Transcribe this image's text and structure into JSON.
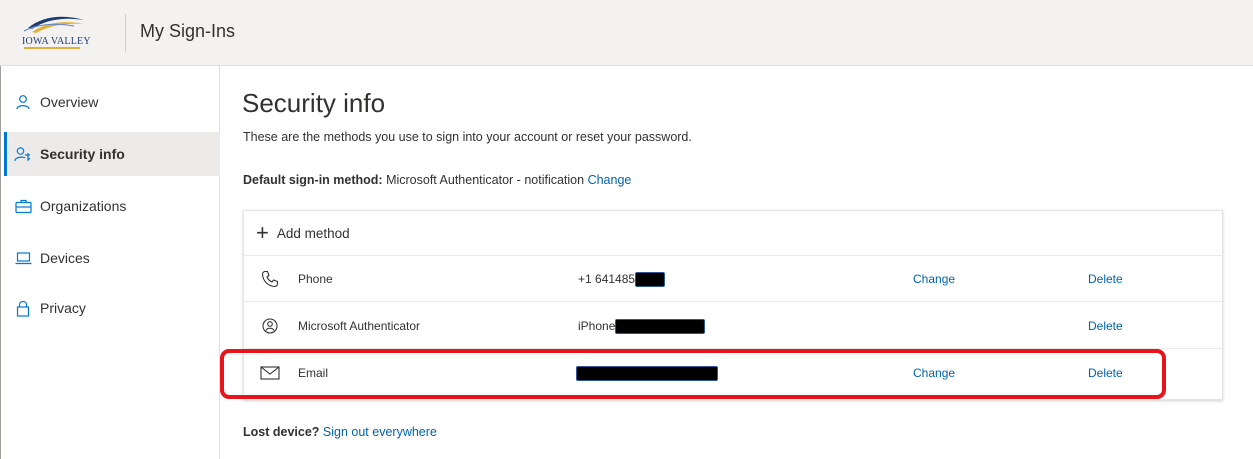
{
  "header": {
    "logo_text": "IOWA VALLEY",
    "app_title": "My Sign-Ins",
    "colors": {
      "background": "#f3f2f1",
      "logo_blue": "#1f3a6e",
      "logo_gold": "#e0b13a"
    }
  },
  "sidebar": {
    "items": [
      {
        "label": "Overview",
        "icon": "person-icon",
        "active": false
      },
      {
        "label": "Security info",
        "icon": "security-person-icon",
        "active": true
      },
      {
        "label": "Organizations",
        "icon": "briefcase-icon",
        "active": false
      },
      {
        "label": "Devices",
        "icon": "laptop-icon",
        "active": false
      },
      {
        "label": "Privacy",
        "icon": "lock-icon",
        "active": false
      }
    ]
  },
  "main": {
    "title": "Security info",
    "subtitle": "These are the methods you use to sign into your account or reset your password.",
    "default_method": {
      "label": "Default sign-in method:",
      "value": "Microsoft Authenticator - notification",
      "change_label": "Change"
    },
    "add_method_label": "Add method",
    "methods": [
      {
        "name": "Phone",
        "icon": "phone-icon",
        "value_prefix": "+1 641485",
        "redacted": true,
        "change_label": "Change",
        "delete_label": "Delete"
      },
      {
        "name": "Microsoft Authenticator",
        "icon": "authenticator-icon",
        "value_prefix": "iPhone",
        "redacted": true,
        "change_label": "",
        "delete_label": "Delete"
      },
      {
        "name": "Email",
        "icon": "mail-icon",
        "value_prefix": "",
        "redacted": true,
        "change_label": "Change",
        "delete_label": "Delete",
        "highlighted": true
      }
    ],
    "lost_device": {
      "label": "Lost device?",
      "link": "Sign out everywhere"
    }
  },
  "colors": {
    "accent": "#0078d4",
    "link": "#0063b1",
    "highlight": "#e8141b",
    "text": "#323130"
  }
}
